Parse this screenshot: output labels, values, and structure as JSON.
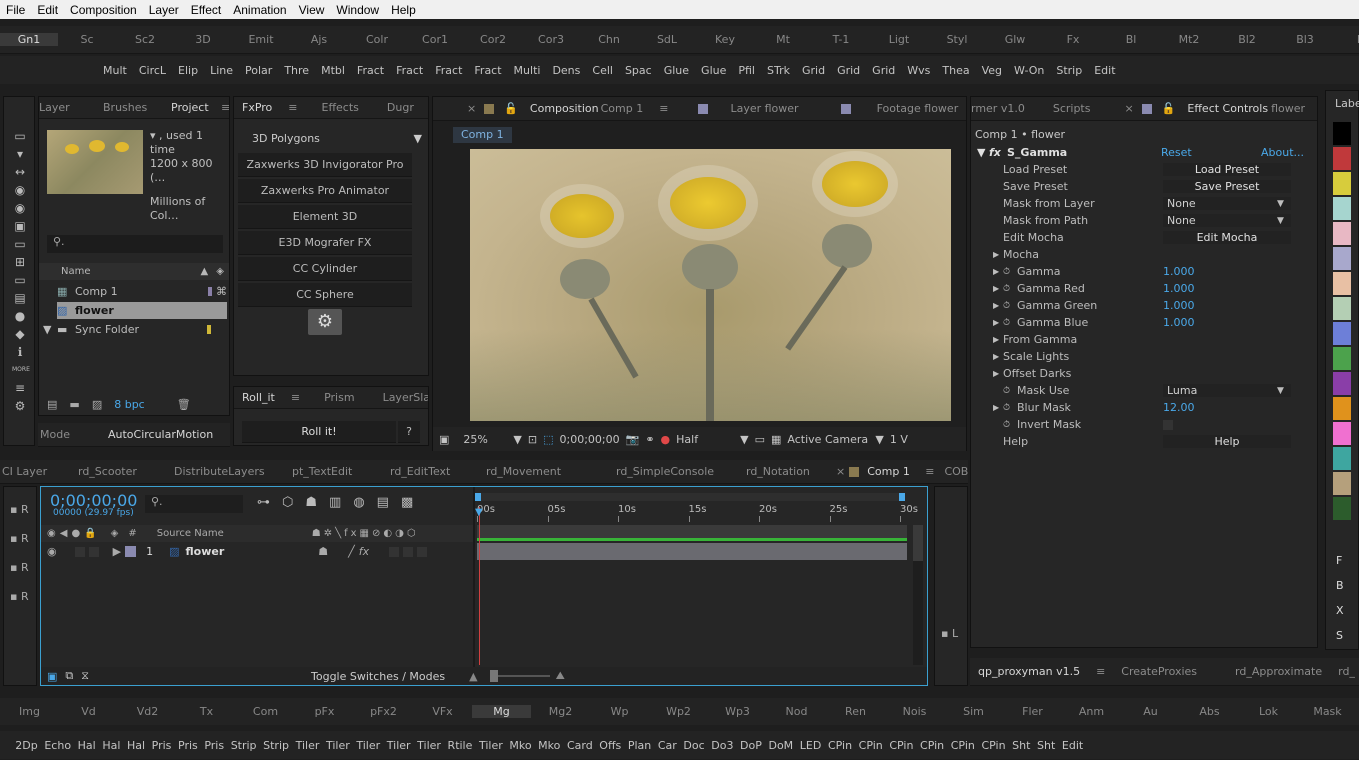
{
  "menu": [
    "File",
    "Edit",
    "Composition",
    "Layer",
    "Effect",
    "Animation",
    "View",
    "Window",
    "Help"
  ],
  "workspace_tabs": [
    "Gn1",
    "Sc",
    "Sc2",
    "3D",
    "Emit",
    "Ajs",
    "Colr",
    "Cor1",
    "Cor2",
    "Cor3",
    "Chn",
    "SdL",
    "Key",
    "Mt",
    "T-1",
    "Ligt",
    "Styl",
    "Glw",
    "Fx",
    "Bl",
    "Mt2",
    "Bl2",
    "Bl3",
    "Ps"
  ],
  "effect_buttons": [
    "Mult",
    "CircL",
    "Elip",
    "Line",
    "Polar",
    "Thre",
    "Mtbl",
    "Fract",
    "Fract",
    "Fract",
    "Fract",
    "Multi",
    "Dens",
    "Cell",
    "Spac",
    "Glue",
    "Glue",
    "Pfil",
    "STrk",
    "Grid",
    "Grid",
    "Grid",
    "Wvs",
    "Thea",
    "Veg",
    "W-On",
    "Strip",
    "Edit"
  ],
  "project": {
    "tabs": [
      "Layer",
      "Brushes",
      "Project"
    ],
    "info_line1": "▾ , used 1 time",
    "info_line2": "1200 x 800 (…",
    "info_line3": "Millions of Col…",
    "name_header": "Name",
    "items": [
      "Comp 1",
      "flower",
      "Sync Folder"
    ],
    "bpc": "8 bpc",
    "bottom_tabs": [
      "Mode",
      "AutoCircularMotion"
    ]
  },
  "fxpro": {
    "tabs": [
      "FxPro",
      "Effects",
      "Dugr"
    ],
    "dropdown": "3D Polygons",
    "buttons": [
      "Zaxwerks 3D Invigorator Pro",
      "Zaxwerks Pro Animator",
      "Element 3D",
      "E3D Mografer FX",
      "CC Cylinder",
      "CC Sphere"
    ],
    "roll_tabs": [
      "Roll_it",
      "Prism",
      "LayerSlayer"
    ],
    "roll_button": "Roll it!",
    "help_q": "?"
  },
  "viewer": {
    "tabs": [
      "Composition",
      "Comp 1",
      "Layer flower",
      "Footage flower"
    ],
    "comp_chip": "Comp 1",
    "zoom": "25%",
    "timecode": "0;00;00;00",
    "resolution": "Half",
    "camera": "Active Camera",
    "views": "1 V"
  },
  "effect_controls": {
    "tabs": [
      "rmer v1.0",
      "Scripts",
      "Effect Controls",
      "flower"
    ],
    "breadcrumb": "Comp 1 • flower",
    "effect_name": "S_Gamma",
    "reset": "Reset",
    "about": "About...",
    "rows": [
      {
        "label": "Load Preset",
        "value": "Load Preset"
      },
      {
        "label": "Save Preset",
        "value": "Save Preset"
      },
      {
        "label": "Mask from Layer",
        "value": "None"
      },
      {
        "label": "Mask from Path",
        "value": "None"
      },
      {
        "label": "Edit Mocha",
        "value": "Edit Mocha"
      },
      {
        "label": "Mocha",
        "value": ""
      },
      {
        "label": "Gamma",
        "value": "1.000"
      },
      {
        "label": "Gamma Red",
        "value": "1.000"
      },
      {
        "label": "Gamma Green",
        "value": "1.000"
      },
      {
        "label": "Gamma Blue",
        "value": "1.000"
      },
      {
        "label": "From Gamma",
        "value": ""
      },
      {
        "label": "Scale Lights",
        "value": ""
      },
      {
        "label": "Offset Darks",
        "value": ""
      },
      {
        "label": "Mask Use",
        "value": "Luma"
      },
      {
        "label": "Blur Mask",
        "value": "12.00"
      },
      {
        "label": "Invert Mask",
        "value": ""
      },
      {
        "label": "Help",
        "value": "Help"
      }
    ]
  },
  "labels": {
    "title": "Label",
    "letters": [
      "F",
      "B",
      "X",
      "S"
    ],
    "colors": [
      "#000000",
      "#c0393b",
      "#d7cc3c",
      "#a6d5cf",
      "#e8b8c4",
      "#a8a8cc",
      "#e8c0a4",
      "#b4cfb4",
      "#6d7fd8",
      "#4ca24c",
      "#8a3ea8",
      "#e0921c",
      "#f070d0",
      "#3ea6a0",
      "#b5a07c",
      "#2c5c2c"
    ]
  },
  "bottom_tabs": [
    "CI Layer",
    "rd_Scooter",
    "DistributeLayers",
    "pt_TextEdit",
    "rd_EditText",
    "rd_Movement",
    "rd_SimpleConsole",
    "rd_Notation",
    "Comp 1",
    "COB"
  ],
  "timeline": {
    "timecode": "0;00;00;00",
    "fps": "00000 (29.97 fps)",
    "col_num": "#",
    "col_source": "Source Name",
    "layer_num": "1",
    "layer_name": "flower",
    "ruler": [
      "00s",
      "05s",
      "10s",
      "15s",
      "20s",
      "25s",
      "30s"
    ],
    "toggle": "Toggle Switches / Modes"
  },
  "proxy_tabs": [
    "qp_proxyman v1.5",
    "CreateProxies",
    "rd_Approximate",
    "rd_"
  ],
  "ws_bottom1": [
    "Img",
    "Vd",
    "Vd2",
    "Tx",
    "Com",
    "pFx",
    "pFx2",
    "VFx",
    "Mg",
    "Mg2",
    "Wp",
    "Wp2",
    "Wp3",
    "Nod",
    "Ren",
    "Nois",
    "Sim",
    "Fler",
    "Anm",
    "Au",
    "Abs",
    "Lok",
    "Mask"
  ],
  "ws_bottom2": [
    "2Dp",
    "Echo",
    "Hal",
    "Hal",
    "Hal",
    "Pris",
    "Pris",
    "Pris",
    "Strip",
    "Strip",
    "Tiler",
    "Tiler",
    "Tiler",
    "Tiler",
    "Tiler",
    "Rtile",
    "Tiler",
    "Mko",
    "Mko",
    "Card",
    "Offs",
    "Plan",
    "Car",
    "Doc",
    "Do3",
    "DoP",
    "DoM",
    "LED",
    "CPin",
    "CPin",
    "CPin",
    "CPin",
    "CPin",
    "CPin",
    "Sht",
    "Sht",
    "Edit"
  ]
}
